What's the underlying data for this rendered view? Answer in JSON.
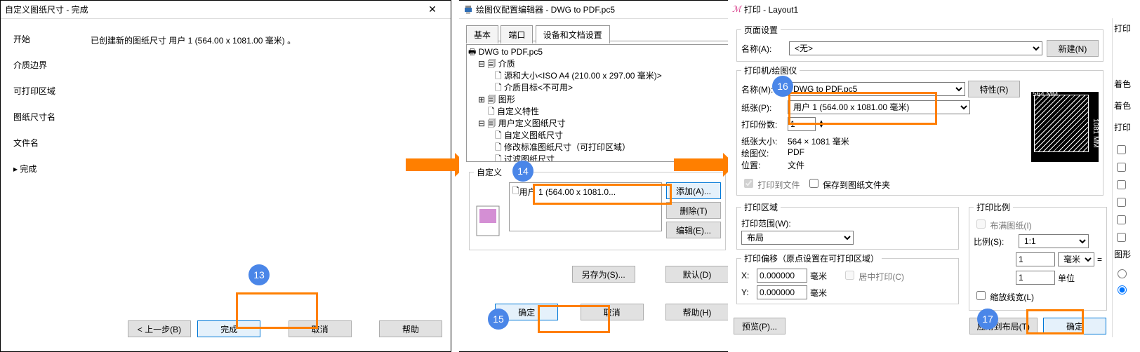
{
  "win1": {
    "title": "自定义图纸尺寸 - 完成",
    "sidebar": [
      "开始",
      "介质边界",
      "可打印区域",
      "图纸尺寸名",
      "文件名",
      "完成"
    ],
    "msg": "已创建新的图纸尺寸 用户 1 (564.00 x 1081.00 毫米) 。",
    "back": "< 上一步(B)",
    "finish": "完成",
    "cancel": "取消",
    "help": "帮助"
  },
  "win2": {
    "title": "绘图仪配置编辑器 - DWG to PDF.pc5",
    "tabs": {
      "basic": "基本",
      "port": "端口",
      "dev": "设备和文档设置"
    },
    "tree": {
      "root": "DWG to PDF.pc5",
      "media": "介质",
      "media_size": "源和大小<ISO A4 (210.00 x 297.00 毫米)>",
      "media_target": "介质目标<不可用>",
      "graphics": "图形",
      "custom_props": "自定义特性",
      "user_paper": "用户定义图纸尺寸",
      "user_paper_custom": "自定义图纸尺寸",
      "user_paper_mod": "修改标准图纸尺寸（可打印区域）",
      "user_paper_filter": "过滤图纸尺寸"
    },
    "custom_hdr": "自定义",
    "list_item": "用户 1 (564.00 x 1081.0...",
    "btns": {
      "add": "添加(A)...",
      "del": "删除(T)",
      "edit": "编辑(E)...",
      "saveas": "另存为(S)...",
      "default": "默认(D)",
      "ok": "确定",
      "cancel": "取消",
      "help": "帮助(H)"
    }
  },
  "win3": {
    "title": "打印 - Layout1",
    "page_setup": "页面设置",
    "name_lbl": "名称(A):",
    "name_val": "<无>",
    "new": "新建(N)",
    "printer_grp": "打印机/绘图仪",
    "printer_name_lbl": "名称(M):",
    "printer_name": "DWG to PDF.pc5",
    "props": "特性(R)",
    "paper_lbl": "纸张(P):",
    "paper": "用户 1 (564.00 x 1081.00 毫米)",
    "copies_lbl": "打印份数:",
    "copies": "1",
    "paper_size_lbl": "纸张大小:",
    "paper_size": "564 × 1081 毫米",
    "plotter_lbl": "绘图仪:",
    "plotter": "PDF",
    "location_lbl": "位置:",
    "location": "文件",
    "to_file": "打印到文件",
    "save_to_folder": "保存到图纸文件夹",
    "print_area": "打印区域",
    "range_lbl": "打印范围(W):",
    "range": "布局",
    "offset_hdr": "打印偏移（原点设置在可打印区域）",
    "x_lbl": "X:",
    "x_val": "0.000000",
    "x_unit": "毫米",
    "y_lbl": "Y:",
    "y_val": "0.000000",
    "y_unit": "毫米",
    "center": "居中打印(C)",
    "scale_grp": "打印比例",
    "fit_paper": "布满图纸(I)",
    "scale_lbl": "比例(S):",
    "scale": "1:1",
    "scale_n": "1",
    "scale_unit": "毫米",
    "eq": "=",
    "scale_d": "1",
    "scale_du": "单位",
    "scale_lw": "缩放线宽(L)",
    "preview": "预览(P)...",
    "apply_layout": "应用到布局(T)",
    "ok": "确定",
    "right_tabs": {
      "t1": "打印",
      "t2": "着色",
      "t3": "着色",
      "t4": "打印",
      "t5": "图形"
    },
    "dim_w": "564 MM",
    "dim_h": "1081 MM"
  }
}
